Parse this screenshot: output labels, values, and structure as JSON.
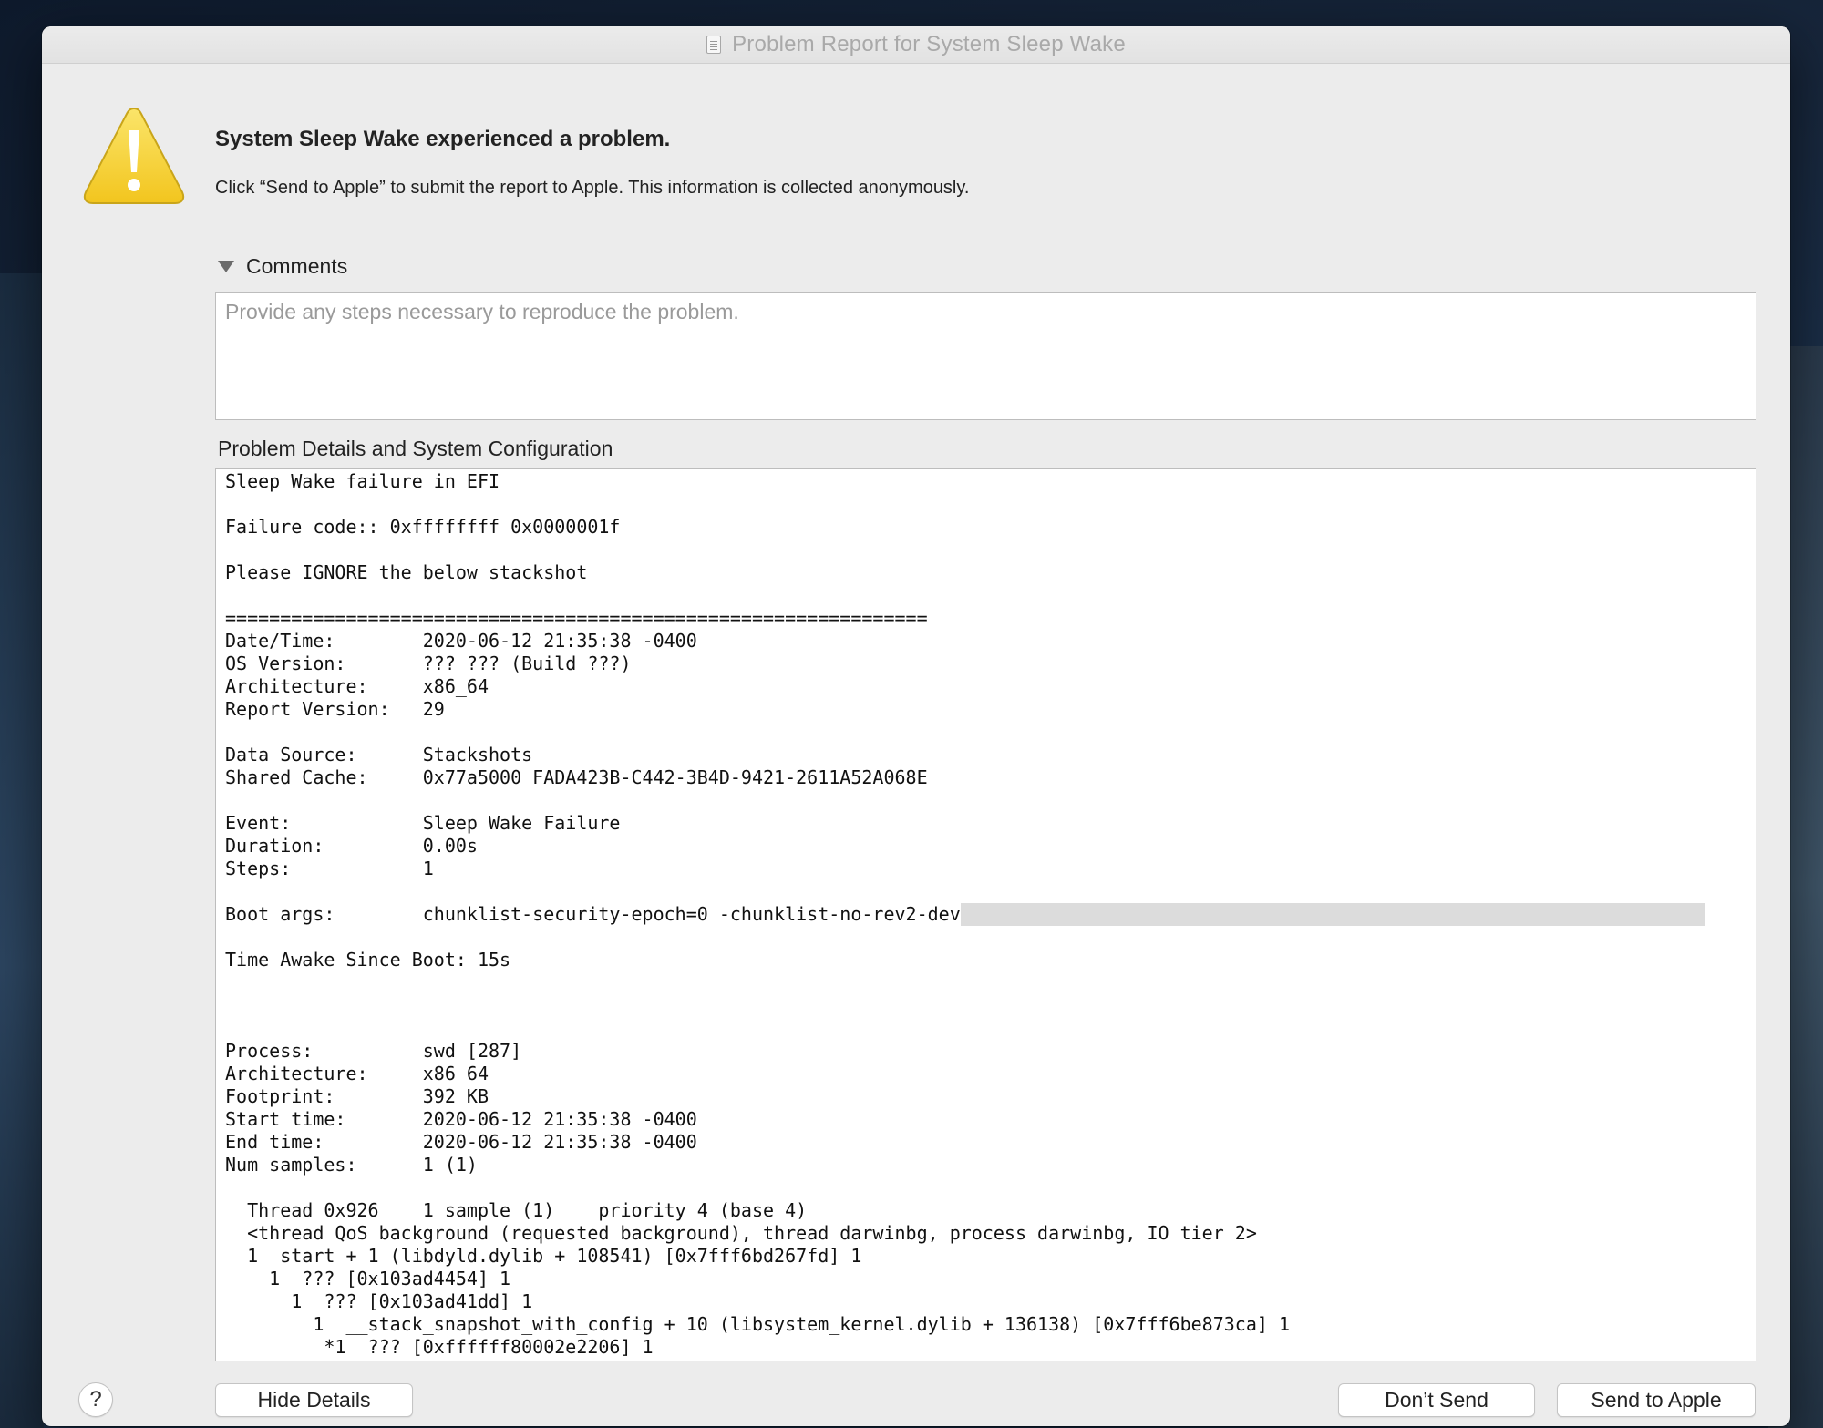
{
  "window": {
    "title": "Problem Report for System Sleep Wake"
  },
  "header": {
    "headline": "System Sleep Wake experienced a problem.",
    "subtext": "Click “Send to Apple” to submit the report to Apple. This information is collected anonymously."
  },
  "comments": {
    "label": "Comments",
    "placeholder": "Provide any steps necessary to reproduce the problem.",
    "value": ""
  },
  "details": {
    "label": "Problem Details and System Configuration",
    "lines": [
      "Sleep Wake failure in EFI",
      "",
      "Failure code:: 0xffffffff 0x0000001f",
      "",
      "Please IGNORE the below stackshot",
      "",
      "================================================================",
      "Date/Time:        2020-06-12 21:35:38 -0400",
      "OS Version:       ??? ??? (Build ???)",
      "Architecture:     x86_64",
      "Report Version:   29",
      "",
      "Data Source:      Stackshots",
      "Shared Cache:     0x77a5000 FADA423B-C442-3B4D-9421-2611A52A068E",
      "",
      "Event:            Sleep Wake Failure",
      "Duration:         0.00s",
      "Steps:            1",
      "",
      "Boot args:        chunklist-security-epoch=0 -chunklist-no-rev2-dev",
      "",
      "Time Awake Since Boot: 15s",
      "",
      "",
      "",
      "Process:          swd [287]",
      "Architecture:     x86_64",
      "Footprint:        392 KB",
      "Start time:       2020-06-12 21:35:38 -0400",
      "End time:         2020-06-12 21:35:38 -0400",
      "Num samples:      1 (1)",
      "",
      "  Thread 0x926    1 sample (1)    priority 4 (base 4)",
      "  <thread QoS background (requested background), thread darwinbg, process darwinbg, IO tier 2>",
      "  1  start + 1 (libdyld.dylib + 108541) [0x7fff6bd267fd] 1",
      "    1  ??? [0x103ad4454] 1",
      "      1  ??? [0x103ad41dd] 1",
      "        1  __stack_snapshot_with_config + 10 (libsystem_kernel.dylib + 136138) [0x7fff6be873ca] 1",
      "         *1  ??? [0xffffff80002e2206] 1"
    ]
  },
  "buttons": {
    "help": "?",
    "hide_details": "Hide Details",
    "dont_send": "Don’t Send",
    "send_to_apple": "Send to Apple"
  },
  "colors": {
    "warning_yellow": "#f7d53a",
    "warning_border": "#c9a51a"
  },
  "icons": {
    "warning": "warning-triangle-icon",
    "document": "document-icon",
    "disclosure": "disclosure-triangle-icon"
  }
}
